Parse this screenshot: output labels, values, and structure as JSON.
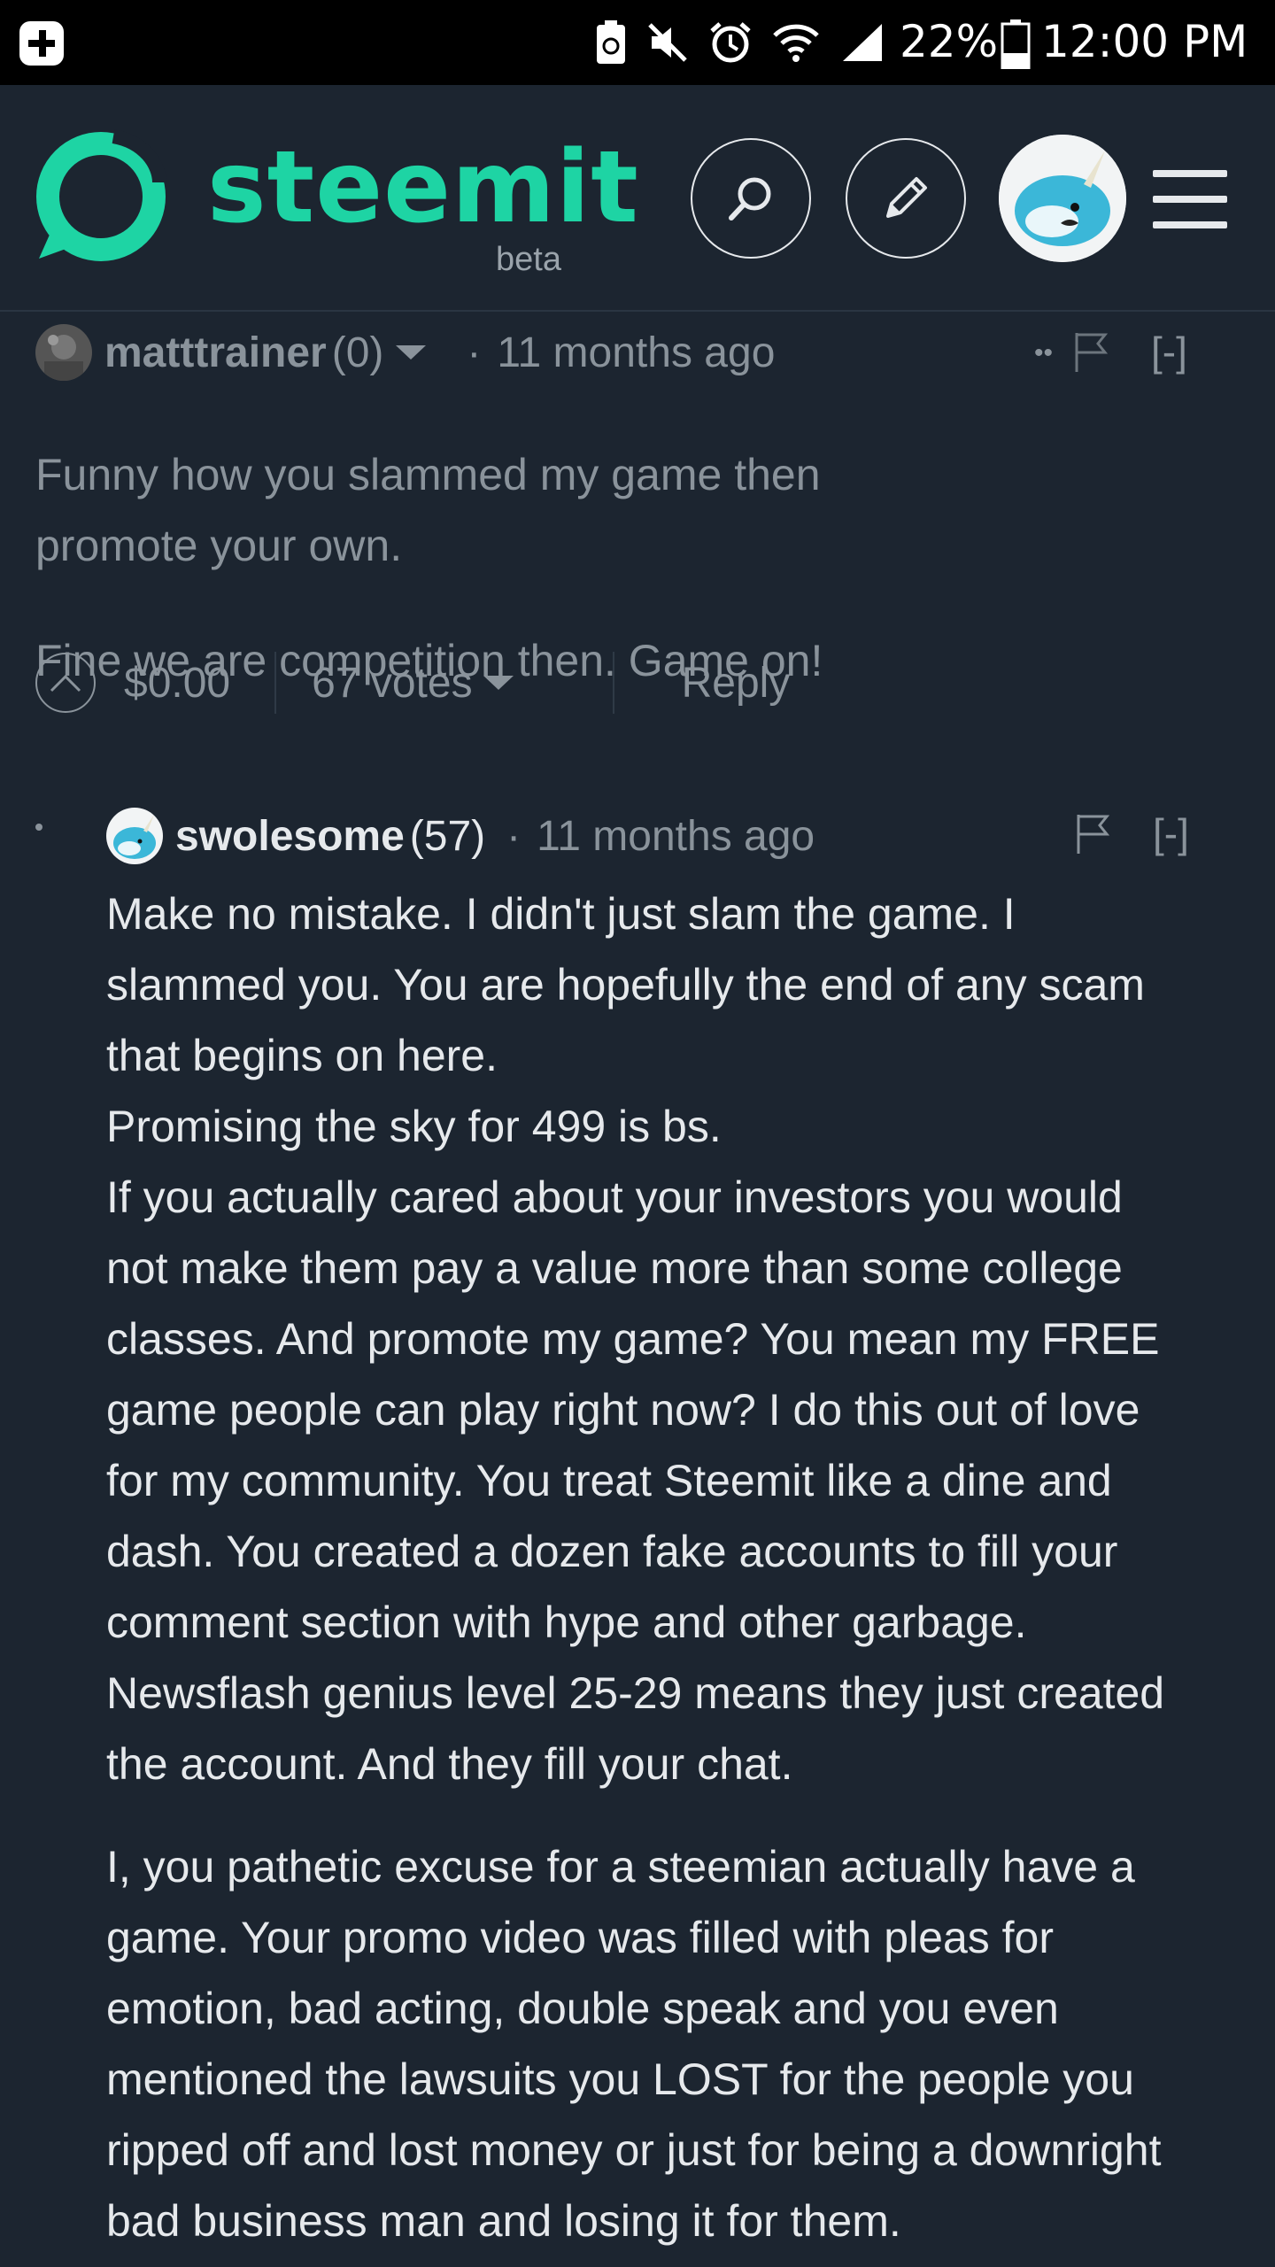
{
  "status_bar": {
    "battery": "22%",
    "time": "12:00 PM"
  },
  "header": {
    "logo_text": "steemit",
    "logo_sub": "beta",
    "icons": [
      "search-icon",
      "pencil-icon",
      "user-avatar",
      "menu-icon"
    ]
  },
  "comments": [
    {
      "author": "matttrainer",
      "reputation": "(0)",
      "time": "11 months ago",
      "collapse": "[-]",
      "paragraphs": [
        "Funny how you slammed my game then promote your own.",
        "Fine we are competition then. Game on!"
      ],
      "payout": "$0.00",
      "votes": "67 votes",
      "reply": "Reply"
    },
    {
      "author": "swolesome",
      "reputation": "(57)",
      "time": "11 months ago",
      "collapse": "[-]",
      "lines_block1": [
        "Make no mistake. I didn't just slam the game. I",
        "slammed you. You are hopefully the end of any scam",
        "that begins on here.",
        "Promising the sky for 499 is bs.",
        "If you actually cared about your investors you would",
        "not make them pay a value more than some college",
        "classes. And promote my game? You mean my FREE",
        "game people can play right now? I do this out of love",
        "for my community. You treat Steemit like a dine and",
        "dash. You created a dozen fake accounts to fill your",
        "comment section with hype and other garbage.",
        "Newsflash genius level 25-29 means they just created",
        "the account. And they fill your chat."
      ],
      "lines_block2": [
        "I, you pathetic excuse for a steemian actually have a",
        "game. Your promo video was filled with pleas for",
        "emotion, bad acting, double speak and you even",
        "mentioned the lawsuits you LOST for the people you",
        "ripped off and lost money or just for being a downright",
        "bad business man and losing it for them."
      ]
    }
  ],
  "colors": {
    "background": "#1c2530",
    "brand": "#1ed4a4",
    "muted_text": "#8a939b",
    "text": "#e6e9ec"
  }
}
